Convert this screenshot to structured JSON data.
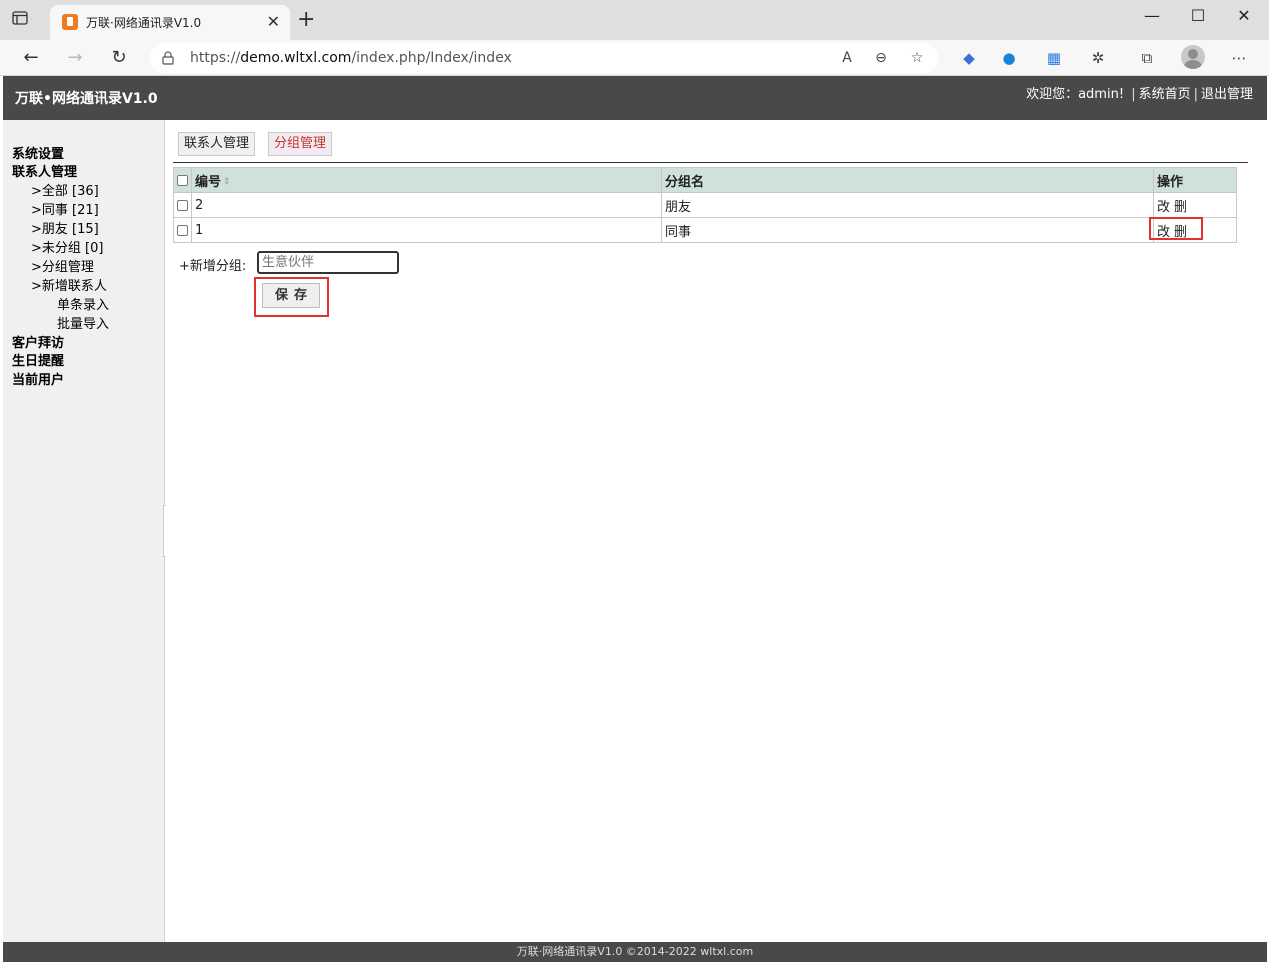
{
  "browser": {
    "tab_title": "万联·网络通讯录V1.0",
    "new_tab_symbol": "+",
    "url_prefix": "https://",
    "url_domain": "demo.wltxl.com",
    "url_path": "/index.php/Index/index",
    "icons": [
      "back-icon",
      "forward-icon",
      "reload-icon",
      "lock-icon",
      "read-aloud-icon",
      "zoom-out-icon",
      "favorite-icon",
      "extensions-icon",
      "collections-icon",
      "profile-icon",
      "more-icon"
    ]
  },
  "app": {
    "title": "万联•网络通讯录V1.0",
    "welcome": "欢迎您：admin!",
    "home_link": "系统首页",
    "logout_link": "退出管理"
  },
  "sidebar": {
    "system_settings": "系统设置",
    "contact_mgmt": "联系人管理",
    "items": [
      ">全部 [36]",
      ">同事 [21]",
      ">朋友 [15]",
      ">未分组 [0]",
      ">分组管理",
      ">新增联系人"
    ],
    "sub_items": [
      "单条录入",
      "批量导入"
    ],
    "customer_visit": "客户拜访",
    "birthday": "生日提醒",
    "current_user": "当前用户"
  },
  "main": {
    "tabs": [
      {
        "label": "联系人管理",
        "active": false
      },
      {
        "label": "分组管理",
        "active": true
      }
    ],
    "table": {
      "headers": [
        "编号",
        "分组名",
        "操作"
      ],
      "rows": [
        {
          "id": "2",
          "name": "朋友",
          "edit": "改",
          "delete": "删"
        },
        {
          "id": "1",
          "name": "同事",
          "edit": "改",
          "delete": "删"
        }
      ]
    },
    "new_group_label": "+新增分组:",
    "new_group_placeholder": "生意伙伴",
    "save_label": "保存"
  },
  "footer": {
    "text": "万联·网络通讯录V1.0 ©2014-2022 wltxl.com"
  },
  "colors": {
    "header_bg": "#494949",
    "table_header_bg": "#cfe0dd",
    "highlight": "#e0322f",
    "active_tab_text": "#c0392b"
  }
}
